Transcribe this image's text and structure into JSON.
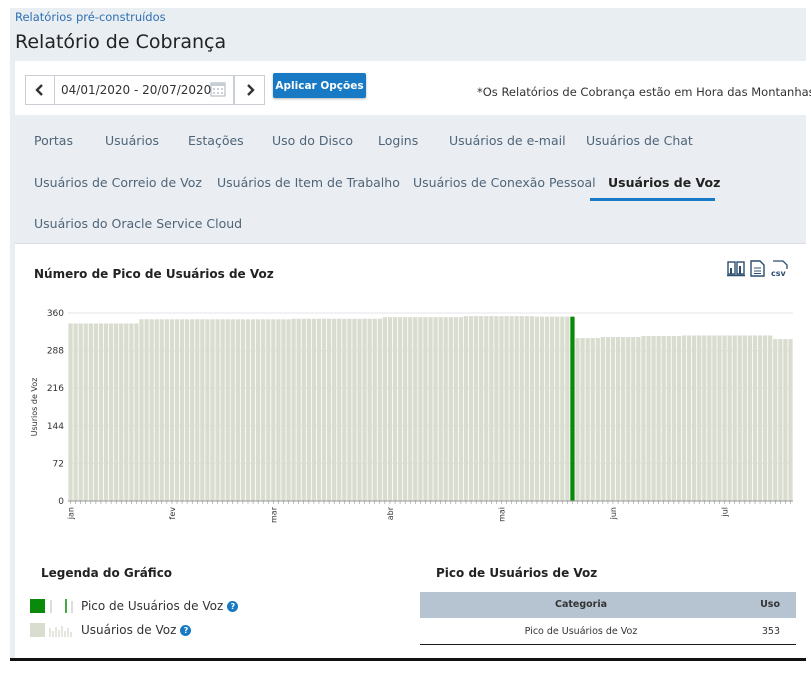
{
  "breadcrumb": "Relatórios pré-construídos",
  "page_title": "Relatório de Cobrança",
  "options": {
    "date_range": "04/01/2020 - 20/07/2020",
    "apply_label": "Aplicar Opções",
    "notice": "*Os Relatórios de Cobrança estão em Hora das Montanhas"
  },
  "tabs": [
    {
      "label": "Portas"
    },
    {
      "label": "Usuários"
    },
    {
      "label": "Estações"
    },
    {
      "label": "Uso do Disco"
    },
    {
      "label": "Logins"
    },
    {
      "label": "Usuários de e-mail"
    },
    {
      "label": "Usuários de Chat"
    },
    {
      "label": "Usuários de Correio de Voz"
    },
    {
      "label": "Usuários de Item de Trabalho"
    },
    {
      "label": "Usuários de Conexão Pessoal"
    },
    {
      "label": "Usuários de Voz"
    },
    {
      "label": "Usuários do Oracle Service Cloud"
    }
  ],
  "active_tab": "Usuários de Voz",
  "chart": {
    "title": "Número de Pico de Usuários de Voz",
    "export_icons": [
      "chart-table-icon",
      "document-icon",
      "csv-icon"
    ]
  },
  "chart_data": {
    "type": "bar",
    "ylabel": "Usurios de Voz",
    "ylim": [
      0,
      360
    ],
    "yticks": [
      0,
      72,
      144,
      216,
      288,
      360
    ],
    "month_labels": [
      "jan",
      "fev",
      "mar",
      "abr",
      "mai",
      "jun",
      "jul"
    ],
    "series": [
      {
        "name": "Usuários de Voz",
        "color": "#d9ddd0",
        "segments": [
          {
            "count": 14,
            "value": 340
          },
          {
            "count": 30,
            "value": 348
          },
          {
            "count": 18,
            "value": 349
          },
          {
            "count": 16,
            "value": 352
          },
          {
            "count": 14,
            "value": 354
          },
          {
            "count": 7,
            "value": 353
          },
          {
            "count": 6,
            "value": 312
          },
          {
            "count": 8,
            "value": 314
          },
          {
            "count": 8,
            "value": 316
          },
          {
            "count": 18,
            "value": 317
          },
          {
            "count": 4,
            "value": 310
          }
        ]
      },
      {
        "name": "Pico de Usuários de Voz",
        "color": "#0a8a0a",
        "peak_index": 99,
        "value": 353
      }
    ]
  },
  "legend": {
    "title": "Legenda do Gráfico",
    "items": [
      {
        "label": "Pico de Usuários de Voz",
        "color": "#0a8a0a"
      },
      {
        "label": "Usuários de Voz",
        "color": "#d9ddd0"
      }
    ]
  },
  "peak_table": {
    "title": "Pico de Usuários de Voz",
    "headers": [
      "Categoria",
      "Uso"
    ],
    "rows": [
      {
        "categoria": "Pico de Usuários de Voz",
        "uso": "353"
      }
    ]
  }
}
